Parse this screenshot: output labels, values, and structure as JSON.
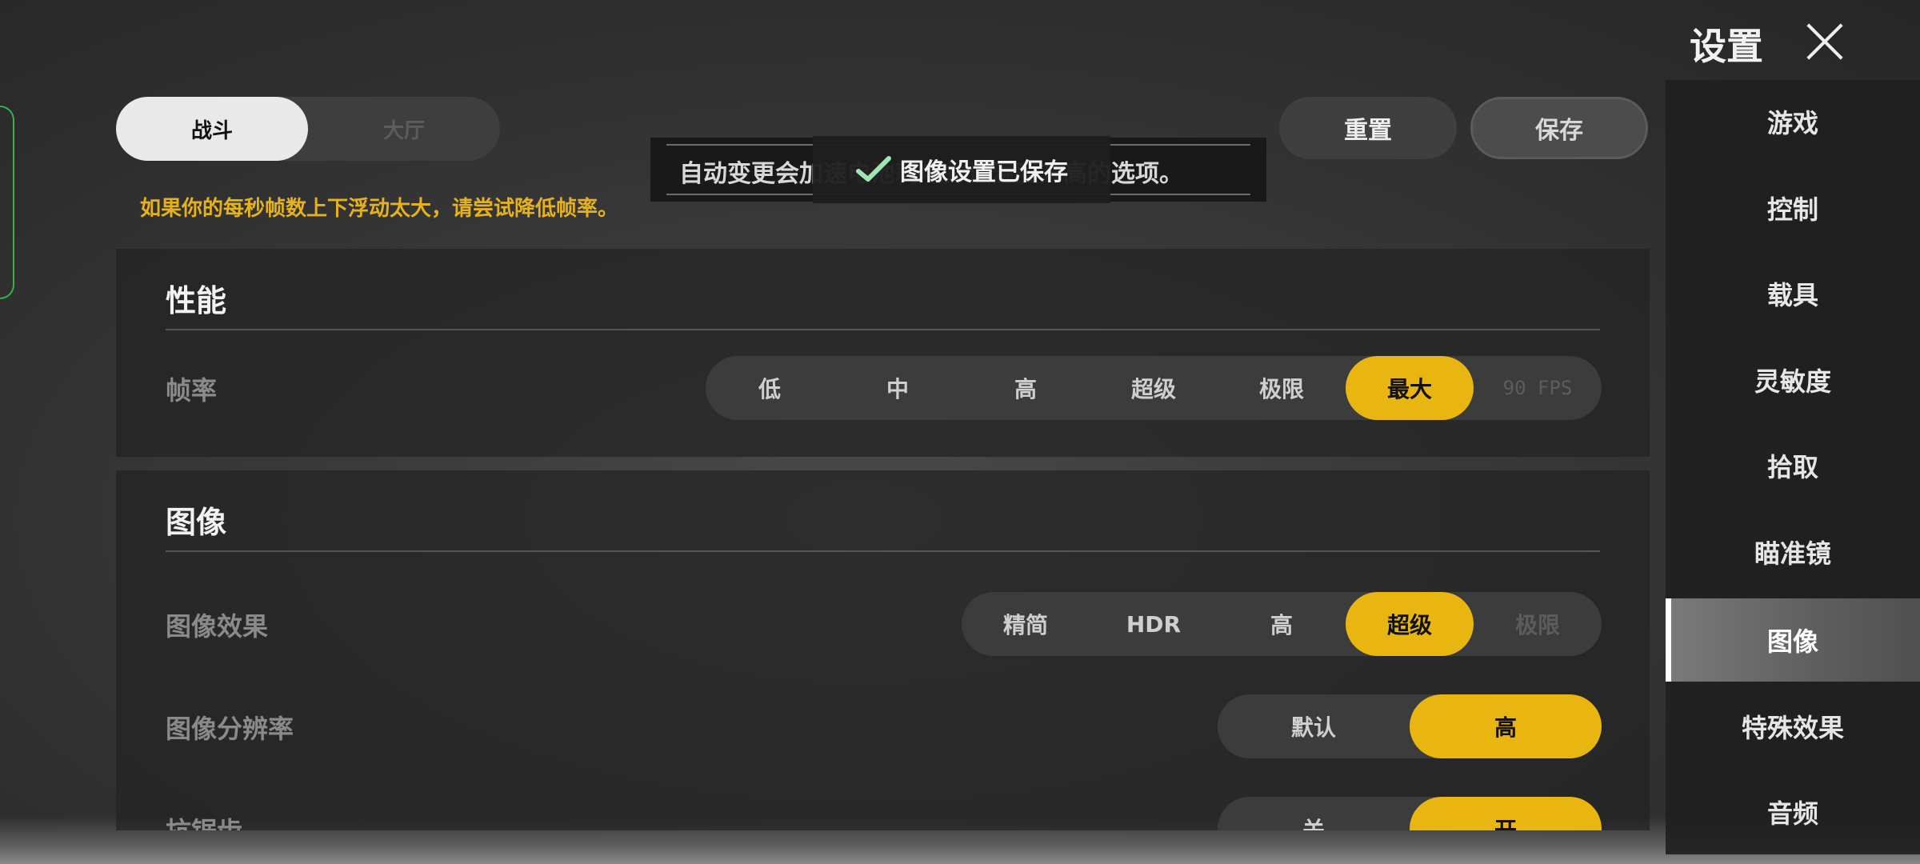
{
  "header": {
    "title": "设置"
  },
  "sidebar": {
    "items": [
      {
        "label": "游戏",
        "active": false
      },
      {
        "label": "控制",
        "active": false
      },
      {
        "label": "载具",
        "active": false
      },
      {
        "label": "灵敏度",
        "active": false
      },
      {
        "label": "拾取",
        "active": false
      },
      {
        "label": "瞄准镜",
        "active": false
      },
      {
        "label": "图像",
        "active": true
      },
      {
        "label": "特殊效果",
        "active": false
      },
      {
        "label": "音频",
        "active": false
      }
    ]
  },
  "mode": {
    "battle": "战斗",
    "lobby": "大厅"
  },
  "toolbar": {
    "reset_label": "重置",
    "save_label": "保存"
  },
  "warning": "如果你的每秒帧数上下浮动太大，请尝试降低帧率。",
  "toast": {
    "background_text": "自动变更会加速电池耗电并让温度升高的选项。",
    "message": "图像设置已保存"
  },
  "performance": {
    "heading": "性能",
    "frame_rate": {
      "label": "帧率",
      "options": [
        "低",
        "中",
        "高",
        "超级",
        "极限",
        "最大",
        "90 FPS"
      ],
      "selected": "最大"
    }
  },
  "graphics": {
    "heading": "图像",
    "style": {
      "label": "图像效果",
      "options": [
        "精简",
        "HDR",
        "高",
        "超级",
        "极限"
      ],
      "selected": "超级"
    },
    "resolution": {
      "label": "图像分辨率",
      "options": [
        "默认",
        "高"
      ],
      "selected": "高"
    },
    "anti_aliasing": {
      "label": "抗锯齿",
      "options": [
        "关",
        "开"
      ],
      "selected": "开"
    }
  },
  "colors": {
    "accent": "#e8b511",
    "warning": "#e5b21d",
    "focus_edge": "#36b34a"
  }
}
